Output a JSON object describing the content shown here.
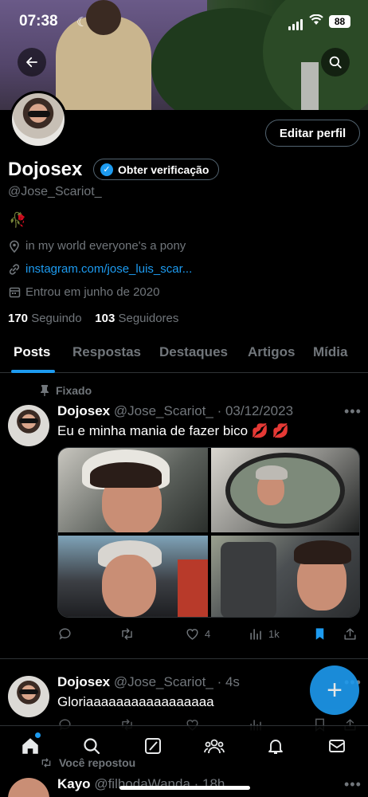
{
  "status_bar": {
    "time": "07:38",
    "battery": "88"
  },
  "profile": {
    "name": "Dojosex",
    "verify_label": "Obter verificação",
    "handle": "@Jose_Scariot_",
    "edit_label": "Editar perfil",
    "bio_emoji": "🥀",
    "location": "in my world everyone's a pony",
    "link": "instagram.com/jose_luis_scar...",
    "joined": "Entrou em junho de 2020",
    "following_count": "170",
    "following_label": "Seguindo",
    "followers_count": "103",
    "followers_label": "Seguidores"
  },
  "tabs": [
    {
      "label": "Posts"
    },
    {
      "label": "Respostas"
    },
    {
      "label": "Destaques"
    },
    {
      "label": "Artigos"
    },
    {
      "label": "Mídia"
    }
  ],
  "tweets": [
    {
      "pinned_label": "Fixado",
      "name": "Dojosex",
      "handle_date": "@Jose_Scariot_ · 03/12/2023",
      "text": "Eu e minha mania de fazer bico 💋 💋",
      "likes": "4",
      "views": "1k"
    },
    {
      "name": "Dojosex",
      "handle_date": "@Jose_Scariot_ · 4s",
      "text": "Gloriaaaaaaaaaaaaaaaaa"
    }
  ],
  "repost": {
    "label": "Você repostou",
    "name": "Kayo",
    "handle_date": "@filhodaWanda · 18h"
  },
  "colors": {
    "accent": "#1d9bf0",
    "background": "#000000",
    "muted": "#71767b"
  }
}
